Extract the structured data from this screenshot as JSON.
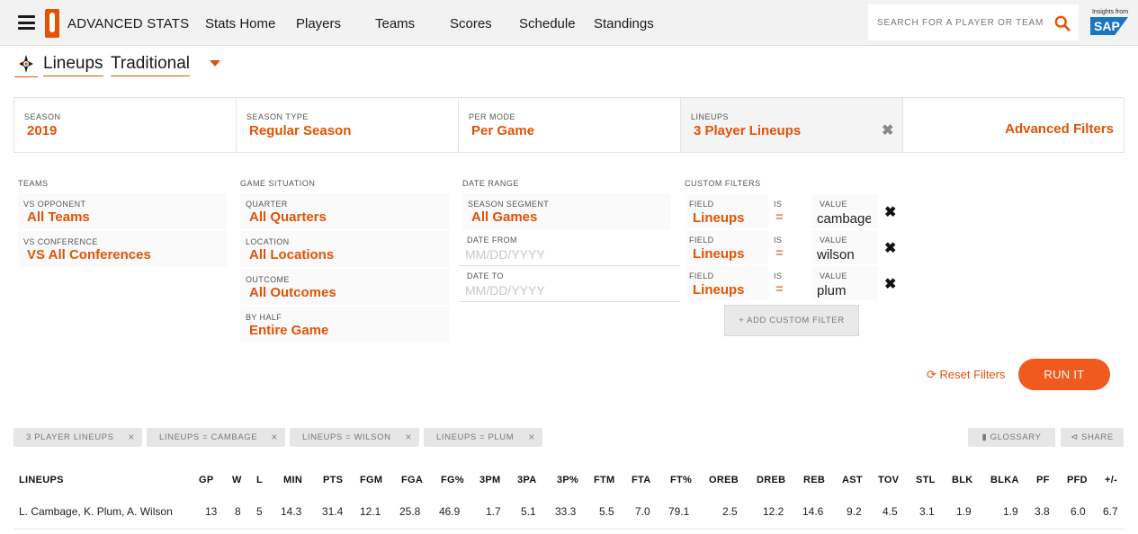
{
  "nav": {
    "brand": "ADVANCED STATS",
    "links": [
      "Stats Home",
      "Players",
      "Teams",
      "Scores",
      "Schedule",
      "Standings"
    ],
    "search_placeholder": "SEARCH FOR A PLAYER OR TEAM",
    "sponsor_small": "Insights from",
    "sponsor_logo": "SAP",
    "accent_color": "#e35205"
  },
  "page": {
    "title_part1": "Lineups",
    "title_part2": "Traditional"
  },
  "main_filters": [
    {
      "label": "SEASON",
      "value": "2019"
    },
    {
      "label": "SEASON TYPE",
      "value": "Regular Season"
    },
    {
      "label": "PER MODE",
      "value": "Per Game"
    },
    {
      "label": "LINEUPS",
      "value": "3 Player Lineups"
    }
  ],
  "advanced_filters_label": "Advanced Filters",
  "teams": {
    "heading": "TEAMS",
    "filters": [
      {
        "label": "VS OPPONENT",
        "value": "All Teams"
      },
      {
        "label": "VS CONFERENCE",
        "value": "VS All Conferences"
      }
    ]
  },
  "game_situation": {
    "heading": "GAME SITUATION",
    "filters": [
      {
        "label": "QUARTER",
        "value": "All Quarters"
      },
      {
        "label": "LOCATION",
        "value": "All Locations"
      },
      {
        "label": "OUTCOME",
        "value": "All Outcomes"
      },
      {
        "label": "BY HALF",
        "value": "Entire Game"
      }
    ]
  },
  "date_range": {
    "heading": "DATE RANGE",
    "segment_label": "SEASON SEGMENT",
    "segment_value": "All Games",
    "from_label": "DATE FROM",
    "from_placeholder": "MM/DD/YYYY",
    "to_label": "DATE TO",
    "to_placeholder": "MM/DD/YYYY"
  },
  "custom_filters": {
    "heading": "CUSTOM FILTERS",
    "field_label": "FIELD",
    "is_label": "IS",
    "value_label": "VALUE",
    "rows": [
      {
        "field": "Lineups",
        "op": "=",
        "value": "cambage"
      },
      {
        "field": "Lineups",
        "op": "=",
        "value": "wilson"
      },
      {
        "field": "Lineups",
        "op": "=",
        "value": "plum"
      }
    ],
    "add_label": "ADD CUSTOM FILTER"
  },
  "actions": {
    "reset": "Reset Filters",
    "run": "RUN IT"
  },
  "chips": [
    "3 PLAYER LINEUPS",
    "LINEUPS = CAMBAGE",
    "LINEUPS = WILSON",
    "LINEUPS = PLUM"
  ],
  "tools": {
    "glossary": "GLOSSARY",
    "share": "SHARE"
  },
  "table": {
    "headers": [
      "LINEUPS",
      "GP",
      "W",
      "L",
      "MIN",
      "PTS",
      "FGM",
      "FGA",
      "FG%",
      "3PM",
      "3PA",
      "3P%",
      "FTM",
      "FTA",
      "FT%",
      "OREB",
      "DREB",
      "REB",
      "AST",
      "TOV",
      "STL",
      "BLK",
      "BLKA",
      "PF",
      "PFD",
      "+/-"
    ],
    "rows": [
      [
        "L. Cambage, K. Plum, A. Wilson",
        "13",
        "8",
        "5",
        "14.3",
        "31.4",
        "12.1",
        "25.8",
        "46.9",
        "1.7",
        "5.1",
        "33.3",
        "5.5",
        "7.0",
        "79.1",
        "2.5",
        "12.2",
        "14.6",
        "9.2",
        "4.5",
        "3.1",
        "1.9",
        "1.9",
        "3.8",
        "6.0",
        "6.7"
      ]
    ]
  }
}
